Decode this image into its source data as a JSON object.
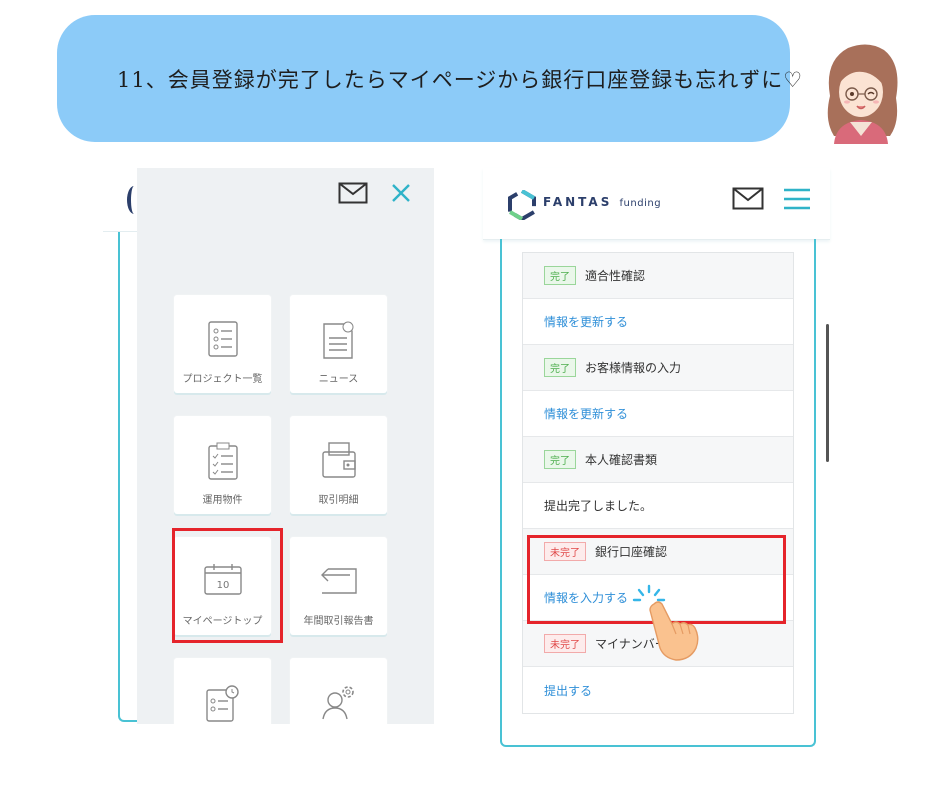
{
  "banner": {
    "text": "11、会員登録が完了したらマイページから銀行口座登録も忘れずに♡"
  },
  "left_menu": {
    "tiles": [
      {
        "label": "プロジェクト一覧",
        "icon": "list-document-icon"
      },
      {
        "label": "ニュース",
        "icon": "news-document-icon"
      },
      {
        "label": "運用物件",
        "icon": "clipboard-checklist-icon"
      },
      {
        "label": "取引明細",
        "icon": "wallet-icon"
      },
      {
        "label": "マイページトップ",
        "icon": "calendar-icon",
        "icon_text": "10"
      },
      {
        "label": "年間取引報告書",
        "icon": "return-arrow-icon"
      },
      {
        "label": "",
        "icon": "clock-checklist-icon"
      },
      {
        "label": "",
        "icon": "user-settings-icon"
      }
    ]
  },
  "right_app": {
    "logo": {
      "brand": "FANTAS",
      "sub": "funding"
    },
    "rows": [
      {
        "type": "status",
        "badge": "完了",
        "badge_state": "done",
        "text": "適合性確認"
      },
      {
        "type": "link",
        "text": "情報を更新する"
      },
      {
        "type": "status",
        "badge": "完了",
        "badge_state": "done",
        "text": "お客様情報の入力"
      },
      {
        "type": "link",
        "text": "情報を更新する"
      },
      {
        "type": "status",
        "badge": "完了",
        "badge_state": "done",
        "text": "本人確認書類"
      },
      {
        "type": "plain",
        "text": "提出完了しました。"
      },
      {
        "type": "status",
        "badge": "未完了",
        "badge_state": "todo",
        "text": "銀行口座確認"
      },
      {
        "type": "link",
        "text": "情報を入力する"
      },
      {
        "type": "status",
        "badge": "未完了",
        "badge_state": "todo",
        "text": "マイナンバー"
      },
      {
        "type": "link",
        "text": "提出する"
      }
    ]
  },
  "colors": {
    "banner_bg": "#8ccbf8",
    "accent_teal": "#49c2d4",
    "highlight_red": "#e5242b",
    "link_blue": "#2f8fd8",
    "done_green": "#4cae4c",
    "todo_red": "#e04848"
  }
}
